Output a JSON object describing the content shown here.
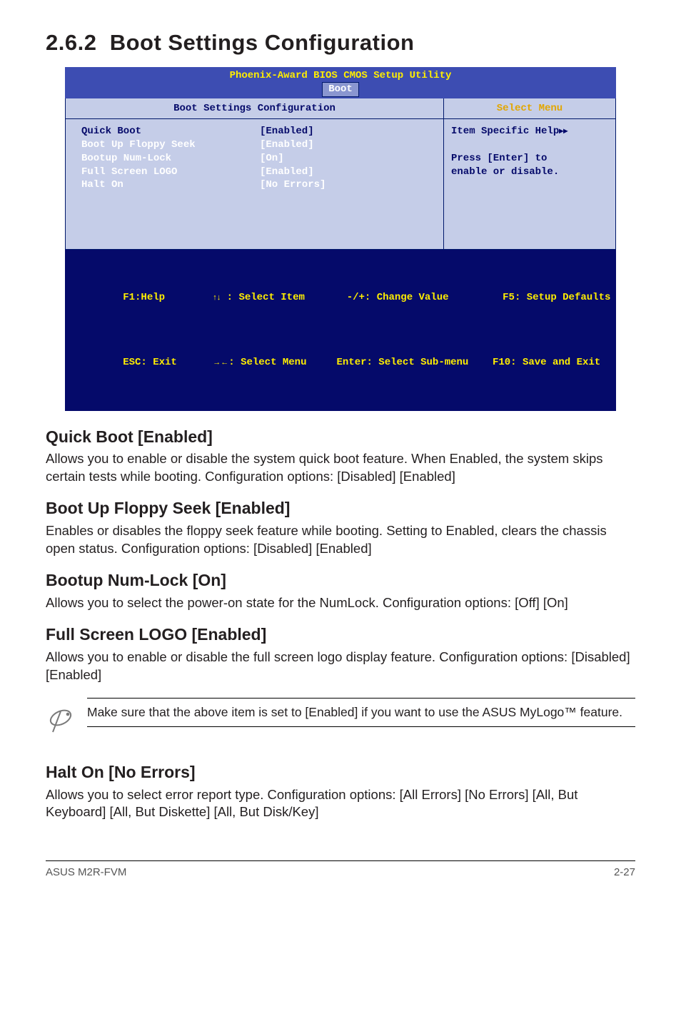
{
  "section": {
    "number": "2.6.2",
    "title": "Boot Settings Configuration"
  },
  "bios": {
    "header": "Phoenix-Award BIOS CMOS Setup Utility",
    "tab": "Boot",
    "left_title": "Boot Settings Configuration",
    "right_title": "Select Menu",
    "items": [
      {
        "label": "Quick Boot",
        "value": "[Enabled]"
      },
      {
        "label": "Boot Up Floppy Seek",
        "value": "[Enabled]"
      },
      {
        "label": "Bootup Num-Lock",
        "value": "[On]"
      },
      {
        "label": "Full Screen LOGO",
        "value": "[Enabled]"
      },
      {
        "label": "Halt On",
        "value": "[No Errors]"
      }
    ],
    "help": {
      "line1": "Item Specific Help",
      "line2": "Press [Enter] to",
      "line3": "enable or disable."
    },
    "footer": {
      "l1a": "F1:Help",
      "l1b": " : Select Item",
      "l1c": "-/+: Change Value",
      "l1d": "F5: Setup Defaults",
      "l2a": "ESC: Exit",
      "l2b": ": Select Menu",
      "l2c": "Enter: Select Sub-menu",
      "l2d": "F10: Save and Exit"
    }
  },
  "subsections": {
    "quickboot": {
      "heading": "Quick Boot [Enabled]",
      "body": "Allows you to enable or disable the system quick boot feature. When Enabled, the system skips certain tests while booting. Configuration options: [Disabled] [Enabled]"
    },
    "floppy": {
      "heading": "Boot Up Floppy Seek [Enabled]",
      "body": "Enables or disables the floppy seek feature while booting. Setting to Enabled, clears the chassis open status. Configuration options: [Disabled] [Enabled]"
    },
    "numlock": {
      "heading": "Bootup Num-Lock [On]",
      "body": "Allows you to select the power-on state for the NumLock. Configuration options: [Off] [On]"
    },
    "logo": {
      "heading": "Full Screen LOGO [Enabled]",
      "body": "Allows you to enable or disable the full screen logo display feature. Configuration options: [Disabled] [Enabled]"
    },
    "note": "Make sure that the above item is set to [Enabled] if you want to use the ASUS MyLogo™ feature.",
    "halton": {
      "heading": "Halt On [No Errors]",
      "body": "Allows you to select error report type. Configuration options: [All Errors] [No Errors] [All, But Keyboard] [All, But Diskette] [All, But Disk/Key]"
    }
  },
  "footer": {
    "left": "ASUS M2R-FVM",
    "right": "2-27"
  }
}
